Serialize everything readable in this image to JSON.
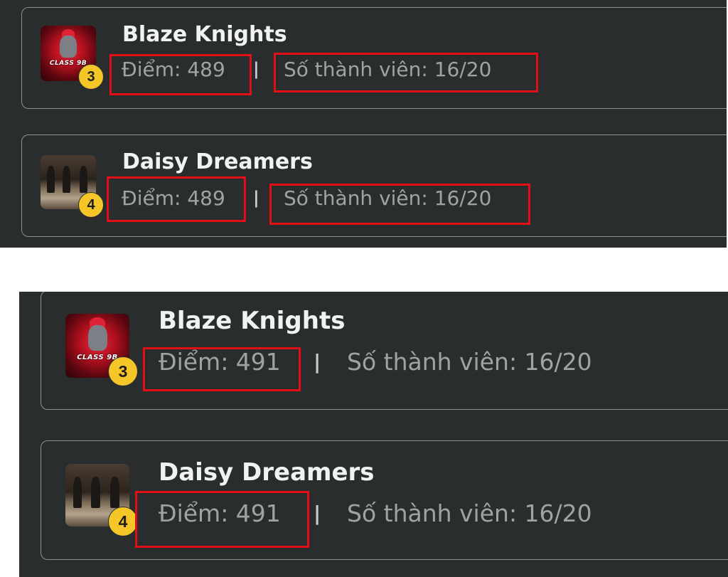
{
  "before": {
    "teams": [
      {
        "name": "Blaze Knights",
        "rank": "3",
        "score_label": "Điểm: 489",
        "members_label": "Số thành viên: 16/20",
        "avatar_text": "CLASS 9B"
      },
      {
        "name": "Daisy Dreamers",
        "rank": "4",
        "score_label": "Điểm: 489",
        "members_label": "Số thành viên: 16/20"
      }
    ]
  },
  "after": {
    "teams": [
      {
        "name": "Blaze Knights",
        "rank": "3",
        "score_label": "Điểm: 491",
        "members_label": "Số thành viên: 16/20",
        "avatar_text": "CLASS 9B"
      },
      {
        "name": "Daisy Dreamers",
        "rank": "4",
        "score_label": "Điểm: 491",
        "members_label": "Số thành viên: 16/20"
      }
    ]
  },
  "separator": "|",
  "colors": {
    "panel_bg": "#2a2d2e",
    "card_border": "#8e9294",
    "name_text": "#f1f2f2",
    "stat_text": "#9fa3a4",
    "rank_badge": "#f5c628",
    "highlight": "#e30f16"
  }
}
